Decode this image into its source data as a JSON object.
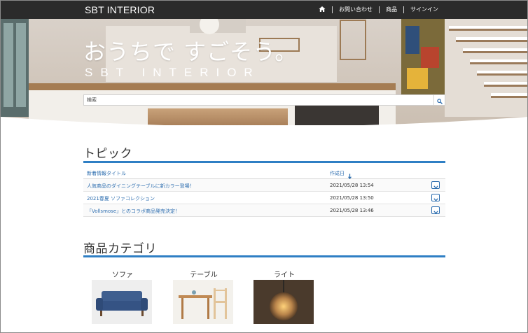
{
  "header": {
    "brand": "SBT INTERIOR",
    "nav": [
      {
        "icon": "home-icon"
      },
      {
        "label": "お問い合わせ"
      },
      {
        "label": "商品"
      },
      {
        "label": "サインイン"
      }
    ]
  },
  "hero": {
    "title": "おうちで すごそう。",
    "subtitle": "SBT INTERIOR",
    "search_placeholder": "検索",
    "search_icon": "search-icon"
  },
  "topics": {
    "heading": "トピック",
    "columns": {
      "title": "新着情報タイトル",
      "date": "作成日"
    },
    "sort": "descending",
    "rows": [
      {
        "title": "人気商品のダイニングテーブルに新カラー登場！",
        "date": "2021/05/28 13:54"
      },
      {
        "title": "2021春夏 ソファコレクション",
        "date": "2021/05/28 13:50"
      },
      {
        "title": "「Vollsmose」とのコラボ商品発売決定！",
        "date": "2021/05/28 13:46"
      }
    ]
  },
  "categories": {
    "heading": "商品カテゴリ",
    "items": [
      {
        "label": "ソファ"
      },
      {
        "label": "テーブル"
      },
      {
        "label": "ライト"
      }
    ]
  },
  "colors": {
    "accent": "#2f7fc4",
    "topbar": "#2b2b2b",
    "link": "#2f6fb0"
  }
}
